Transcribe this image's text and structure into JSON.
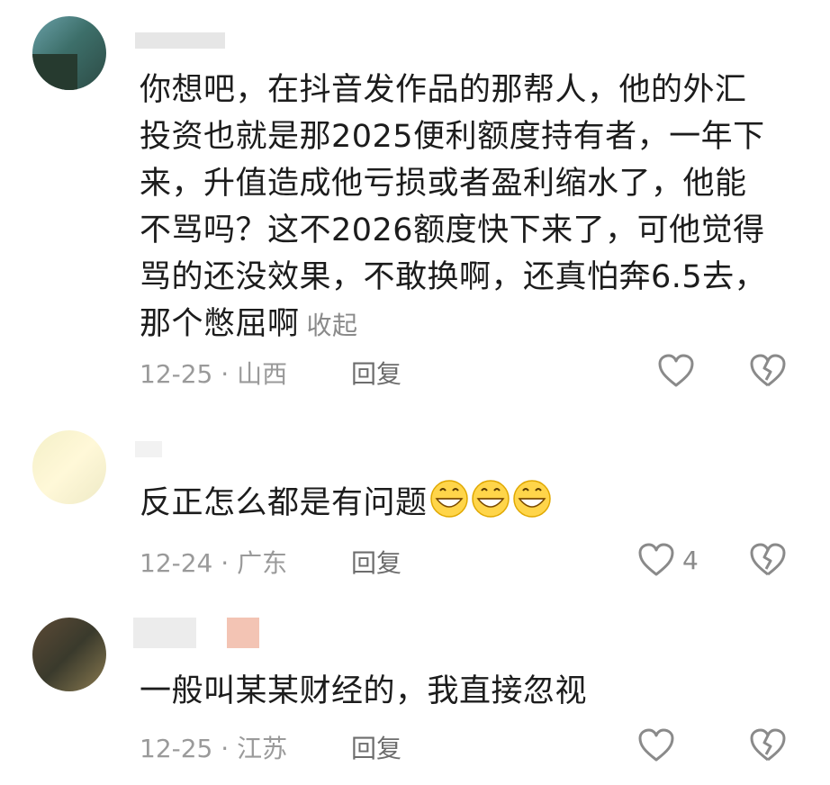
{
  "comments": [
    {
      "text": "你想吧，在抖音发作品的那帮人，他的外汇投资也就是那2025便利额度持有者，一年下来，升值造成他亏损或者盈利缩水了，他能不骂吗？这不2026额度快下来了，可他觉得骂的还没效果，不敢换啊，还真怕奔6.5去，那个憋屈啊",
      "collapse_label": "收起",
      "date": "12-25",
      "location": "山西",
      "reply_label": "回复",
      "like_count": ""
    },
    {
      "text": "反正怎么都是有问题",
      "emoji_count": 3,
      "date": "12-24",
      "location": "广东",
      "reply_label": "回复",
      "like_count": "4"
    },
    {
      "text": "一般叫某某财经的，我直接忽视",
      "date": "12-25",
      "location": "江苏",
      "reply_label": "回复",
      "like_count": ""
    }
  ],
  "meta_separator": "·",
  "colors": {
    "text": "#1c1c1c",
    "meta": "#9a9a9a",
    "icon": "#8a8a8a"
  }
}
